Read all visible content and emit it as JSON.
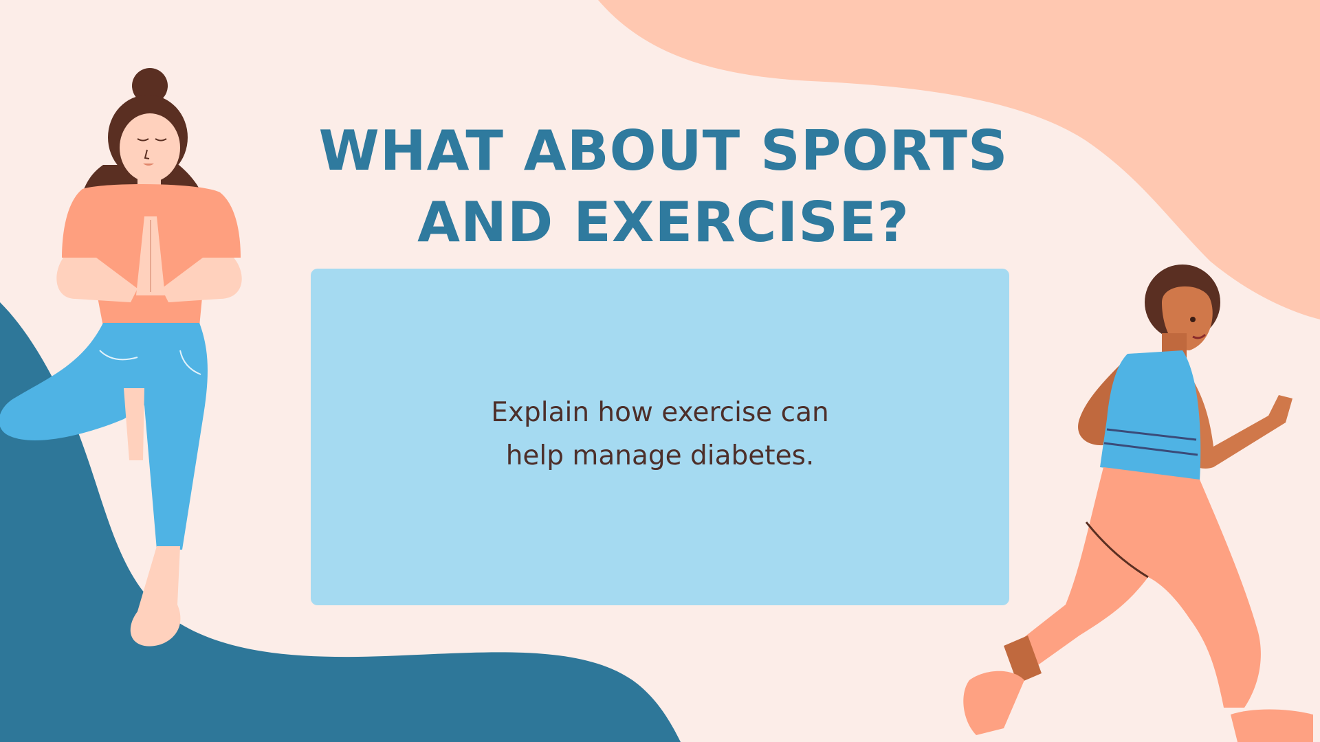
{
  "title": {
    "line1": "WHAT ABOUT SPORTS",
    "line2": "AND EXERCISE?"
  },
  "card": {
    "line1": "Explain how exercise can",
    "line2": "help manage diabetes."
  },
  "colors": {
    "background": "#fcede8",
    "peach_blob": "#ffc8b1",
    "teal_blob": "#2e7799",
    "title": "#2f7a9e",
    "card": "#a5daf1",
    "body_text": "#4d2f2a"
  },
  "illustrations": [
    "yoga-woman-illustration",
    "running-woman-illustration"
  ]
}
